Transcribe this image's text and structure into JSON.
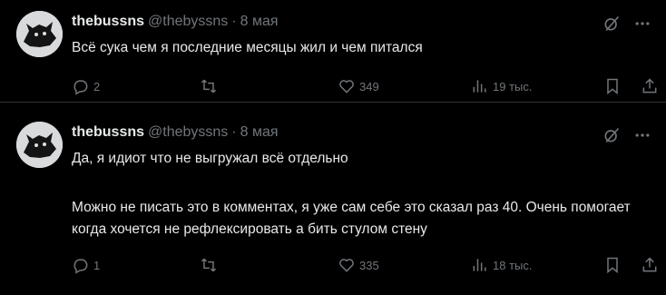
{
  "tweets": [
    {
      "author_name": "thebussns",
      "handle": "@thebyssns",
      "separator": "·",
      "time": "8 мая",
      "text": "Всё сука чем я последние месяцы жил и чем питался",
      "replies": "2",
      "reposts": "",
      "likes": "349",
      "views": "19 тыс."
    },
    {
      "author_name": "thebussns",
      "handle": "@thebyssns",
      "separator": "·",
      "time": "8 мая",
      "text_line1": "Да, я идиот что не выгружал всё отдельно",
      "text_para2": "Можно не писать это в комментах, я уже сам себе это сказал раз 40. Очень помогает когда хочется не рефлексировать а бить стулом стену",
      "replies": "1",
      "reposts": "",
      "likes": "335",
      "views": "18 тыс."
    }
  ],
  "icons": {
    "grok": "grok-icon",
    "more": "more-icon",
    "reply": "reply-icon",
    "repost": "repost-icon",
    "like": "like-icon",
    "views": "views-icon",
    "bookmark": "bookmark-icon",
    "share": "share-icon"
  },
  "colors": {
    "background": "#000000",
    "text": "#e7e9ea",
    "muted": "#71767b",
    "divider": "#2f3336"
  }
}
